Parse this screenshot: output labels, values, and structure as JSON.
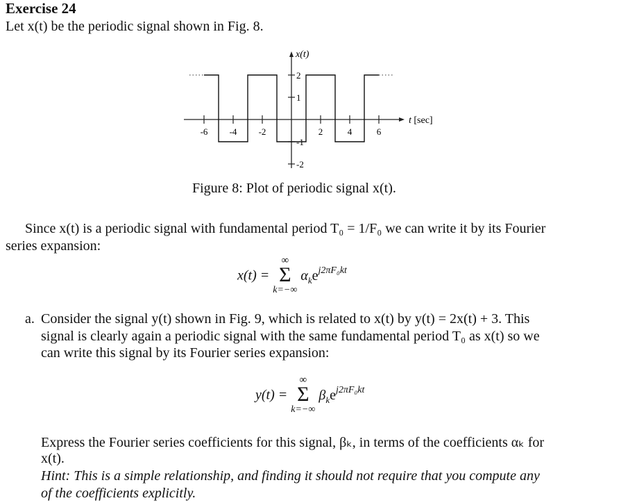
{
  "exercise": {
    "title": "Exercise 24",
    "intro": "Let x(t) be the periodic signal shown in Fig. 8."
  },
  "figure": {
    "caption": "Figure 8: Plot of periodic signal x(t).",
    "ylabel": "x(t)",
    "xlabel": "t [sec]"
  },
  "chart_data": {
    "type": "line",
    "title": "Plot of periodic signal x(t)",
    "xlabel": "t [sec]",
    "ylabel": "x(t)",
    "xlim": [
      -7,
      7
    ],
    "ylim": [
      -2,
      2
    ],
    "x_ticks": [
      -6,
      -4,
      -2,
      2,
      4,
      6
    ],
    "x_tick_labels": [
      "-6",
      "-4",
      "-2",
      "2",
      "4",
      "6"
    ],
    "y_ticks": [
      2,
      1,
      -1,
      -2
    ],
    "y_tick_labels": [
      "2",
      "1",
      "-1",
      "-2"
    ],
    "series": [
      {
        "name": "x(t)",
        "step": true,
        "x": [
          -6,
          -5,
          -5,
          -3,
          -3,
          -1,
          -1,
          1,
          1,
          3,
          3,
          5,
          5,
          6
        ],
        "y": [
          2,
          2,
          -1,
          -1,
          2,
          2,
          -1,
          -1,
          2,
          2,
          -1,
          -1,
          2,
          2
        ]
      }
    ],
    "continuation": {
      "left": {
        "x": [
          -7,
          -6
        ],
        "y": 2
      },
      "right": {
        "x": [
          6,
          7
        ],
        "y": 2
      }
    },
    "grid": false
  },
  "body": {
    "para1_line1": "Since x(t) is a periodic signal with fundamental period T₀ = 1/F₀ we can write it by its Fourier",
    "para1_line2": "series expansion:",
    "eq1": {
      "lhs": "x(t) =",
      "top": "∞",
      "sigma": "Σ",
      "bottom": "k=−∞",
      "coef": "α",
      "coef_sub": "k",
      "base": "e",
      "exponent": "j2πF₀kt"
    },
    "part_a_marker": "a.",
    "part_a_line1": "Consider the signal y(t) shown in Fig. 9, which is related to x(t) by y(t) = 2x(t) + 3. This",
    "part_a_line2": "signal is clearly again a periodic signal with the same fundamental period T₀ as x(t) so we",
    "part_a_line3": "can write this signal by its Fourier series expansion:",
    "eq2": {
      "lhs": "y(t) =",
      "top": "∞",
      "sigma": "Σ",
      "bottom": "k=−∞",
      "coef": "β",
      "coef_sub": "k",
      "base": "e",
      "exponent": "j2πF₀kt"
    },
    "express_line1": "Express the Fourier series coefficients for this signal, βₖ, in terms of the coefficients αₖ for",
    "express_line2": "x(t).",
    "hint_line1": "Hint: This is a simple relationship, and finding it should not require that you compute any",
    "hint_line2": "of the coefficients explicitly."
  }
}
